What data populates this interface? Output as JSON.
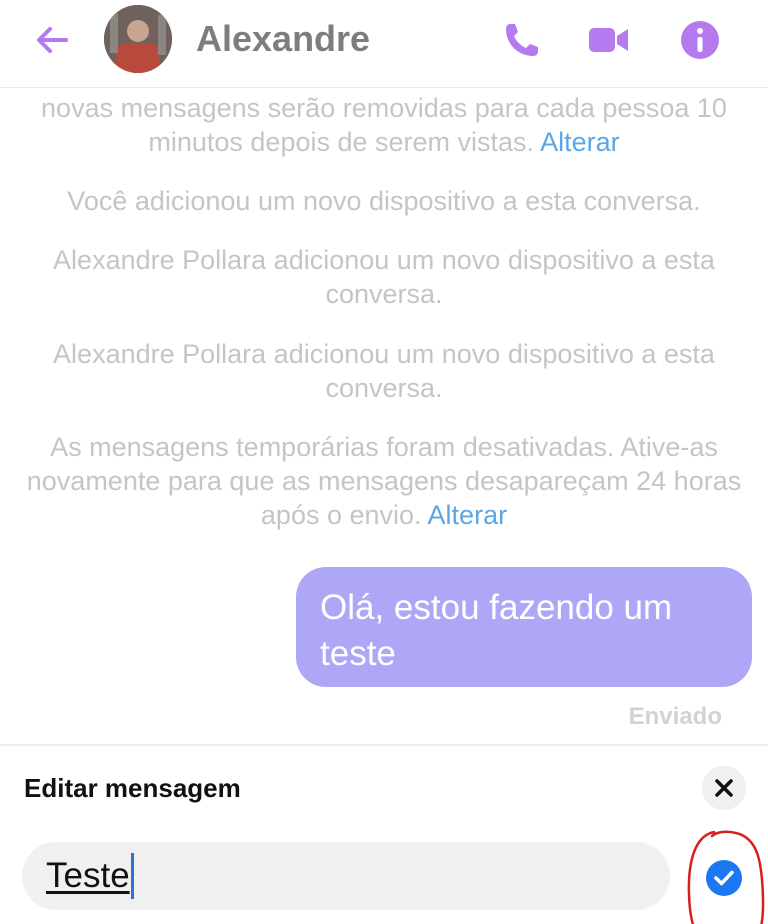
{
  "header": {
    "contact_name": "Alexandre",
    "accent_color": "#b57aef",
    "icons": [
      "back-arrow-icon",
      "phone-icon",
      "video-camera-icon",
      "info-icon"
    ]
  },
  "chat": {
    "system_messages": [
      {
        "text": "novas mensagens serão removidas para cada pessoa 10 minutos depois de serem vistas.",
        "link": "Alterar"
      },
      {
        "text": "Você adicionou um novo dispositivo a esta conversa.",
        "link": ""
      },
      {
        "text": "Alexandre Pollara adicionou um novo dispositivo a esta conversa.",
        "link": ""
      },
      {
        "text": "Alexandre Pollara adicionou um novo dispositivo a esta conversa.",
        "link": ""
      },
      {
        "text": "As mensagens temporárias foram desativadas. Ative-as novamente para que as mensagens desapareçam 24 horas após o envio.",
        "link": "Alterar"
      }
    ],
    "outgoing_message": "Olá, estou fazendo um teste",
    "message_status": "Enviado",
    "bubble_color": "#aea6f7"
  },
  "edit": {
    "title": "Editar mensagem",
    "input_value": "Teste",
    "confirm_color": "#1c78f2"
  }
}
